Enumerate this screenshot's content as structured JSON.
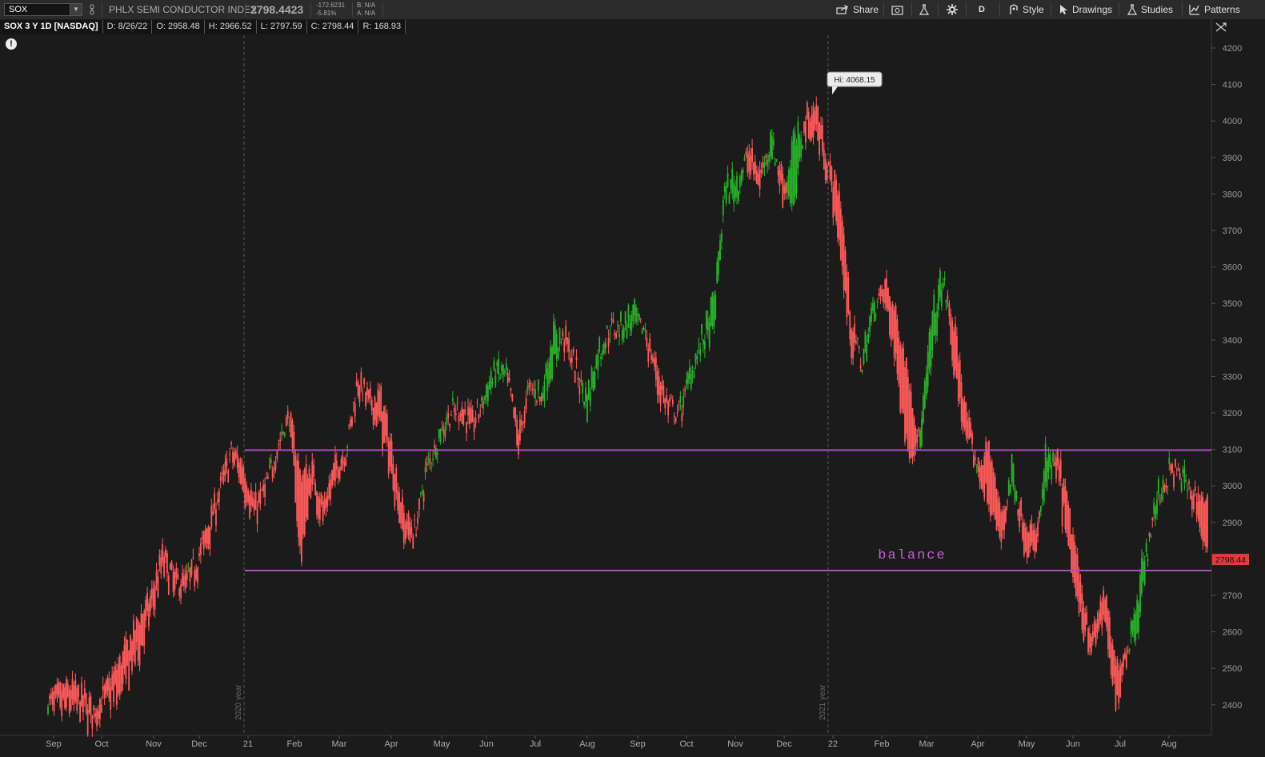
{
  "header": {
    "symbol": "SOX",
    "description": "PHLX SEMI CONDUCTOR INDEX",
    "last": "2798.4423",
    "change": "-172.6231",
    "change_pct": "-5.81%",
    "bid": "B: N/A",
    "ask": "A: N/A"
  },
  "toolbar": {
    "share": "Share",
    "period": "D",
    "style": "Style",
    "drawings": "Drawings",
    "studies": "Studies",
    "patterns": "Patterns"
  },
  "info": {
    "title": "SOX 3 Y 1D [NASDAQ]",
    "date": "D: 8/26/22",
    "open": "O: 2958.48",
    "high": "H: 2966.52",
    "low": "L: 2797.59",
    "close": "C: 2798.44",
    "range": "R: 168.93"
  },
  "chart_data": {
    "type": "candlestick",
    "ylim": [
      2350,
      4250
    ],
    "y_ticks": [
      2400,
      2500,
      2600,
      2700,
      2800,
      2900,
      3000,
      3100,
      3200,
      3300,
      3400,
      3500,
      3600,
      3700,
      3800,
      3900,
      4000,
      4100,
      4200
    ],
    "x_labels": [
      "Sep",
      "Oct",
      "Nov",
      "Dec",
      "21",
      "Feb",
      "Mar",
      "Apr",
      "May",
      "Jun",
      "Jul",
      "Aug",
      "Sep",
      "Oct",
      "Nov",
      "Dec",
      "22",
      "Feb",
      "Mar",
      "Apr",
      "May",
      "Jun",
      "Jul",
      "Aug"
    ],
    "year_markers": [
      "2020 year",
      "2021 year"
    ],
    "high_label": "Hi: 4068.15",
    "last_price_label": "2798.44",
    "annotation": "balance",
    "horizontal_lines": [
      3098,
      2768
    ],
    "path_anchors": [
      [
        2405,
        2405
      ],
      [
        2440,
        2380
      ],
      [
        2450,
        2395
      ],
      [
        2430,
        2380
      ],
      [
        2390,
        2355
      ],
      [
        2440,
        2410
      ],
      [
        2500,
        2420
      ],
      [
        2570,
        2480
      ],
      [
        2640,
        2550
      ],
      [
        2700,
        2650
      ],
      [
        2820,
        2780
      ],
      [
        2750,
        2720
      ],
      [
        2740,
        2720
      ],
      [
        2800,
        2780
      ],
      [
        2900,
        2860
      ],
      [
        3000,
        2980
      ],
      [
        3100,
        3080
      ],
      [
        3060,
        3000
      ],
      [
        2950,
        2910
      ],
      [
        3000,
        2990
      ],
      [
        3110,
        3100
      ],
      [
        3200,
        3190
      ],
      [
        3030,
        2800
      ],
      [
        3050,
        3010
      ],
      [
        2950,
        2900
      ],
      [
        3060,
        3010
      ],
      [
        3100,
        3100
      ],
      [
        3300,
        3280
      ],
      [
        3240,
        3210
      ],
      [
        3250,
        3160
      ],
      [
        3100,
        3020
      ],
      [
        2920,
        2860
      ],
      [
        2880,
        2870
      ],
      [
        3050,
        3050
      ],
      [
        3120,
        3140
      ],
      [
        3200,
        3190
      ],
      [
        3220,
        3200
      ],
      [
        3180,
        3150
      ],
      [
        3230,
        3250
      ],
      [
        3300,
        3330
      ],
      [
        3300,
        3290
      ],
      [
        3150,
        3100
      ],
      [
        3270,
        3280
      ],
      [
        3240,
        3250
      ],
      [
        3330,
        3420
      ],
      [
        3420,
        3400
      ],
      [
        3330,
        3300
      ],
      [
        3200,
        3260
      ],
      [
        3350,
        3380
      ],
      [
        3440,
        3420
      ],
      [
        3420,
        3460
      ],
      [
        3440,
        3470
      ],
      [
        3430,
        3420
      ],
      [
        3330,
        3280
      ],
      [
        3230,
        3200
      ],
      [
        3200,
        3190
      ],
      [
        3290,
        3330
      ],
      [
        3390,
        3400
      ],
      [
        3420,
        3500
      ],
      [
        3800,
        3820
      ],
      [
        3790,
        3850
      ],
      [
        3920,
        3880
      ],
      [
        3860,
        3820
      ],
      [
        3920,
        3980
      ],
      [
        3860,
        3780
      ],
      [
        3750,
        3950
      ],
      [
        4020,
        3980
      ],
      [
        4040,
        3960
      ],
      [
        3880,
        3860
      ],
      [
        3800,
        3640
      ],
      [
        3450,
        3380
      ],
      [
        3320,
        3350
      ],
      [
        3480,
        3520
      ],
      [
        3560,
        3500
      ],
      [
        3450,
        3310
      ],
      [
        3300,
        3080
      ],
      [
        3100,
        3150
      ],
      [
        3350,
        3450
      ],
      [
        3550,
        3580
      ],
      [
        3430,
        3300
      ],
      [
        3200,
        3120
      ],
      [
        3050,
        3040
      ],
      [
        3110,
        2950
      ],
      [
        2920,
        2840
      ],
      [
        3000,
        3060
      ],
      [
        2920,
        2840
      ],
      [
        2860,
        2800
      ],
      [
        3000,
        3100
      ],
      [
        3080,
        3020
      ],
      [
        2920,
        2800
      ],
      [
        2720,
        2640
      ],
      [
        2580,
        2560
      ],
      [
        2720,
        2640
      ],
      [
        2500,
        2400
      ],
      [
        2560,
        2540
      ],
      [
        2620,
        2720
      ],
      [
        2870,
        2880
      ],
      [
        2980,
        3000
      ],
      [
        3060,
        3040
      ],
      [
        3000,
        3020
      ],
      [
        2980,
        2950
      ],
      [
        2958,
        2798
      ]
    ]
  }
}
